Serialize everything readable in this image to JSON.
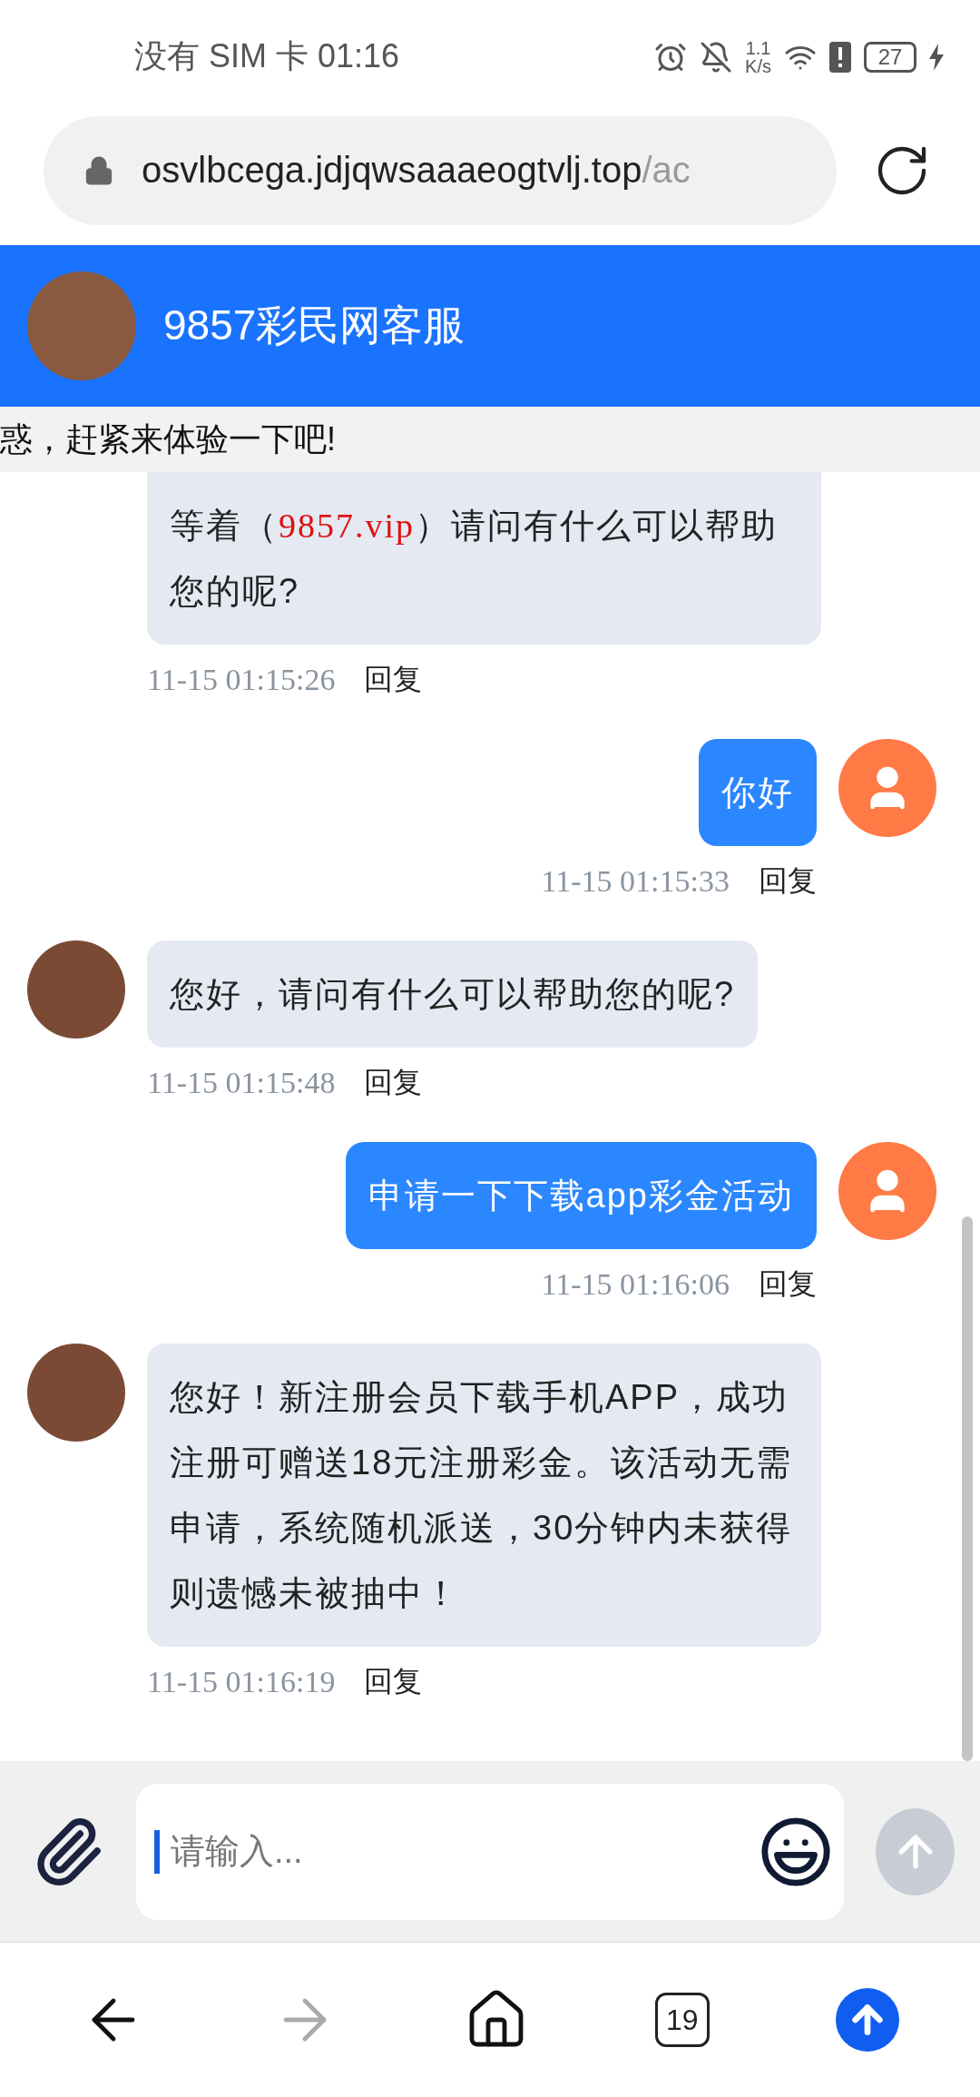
{
  "status_bar": {
    "carrier_time": "没有 SIM 卡 01:16",
    "speed_value": "1.1",
    "speed_unit": "K/s",
    "battery": "27"
  },
  "address_bar": {
    "host": "osvlbcega.jdjqwsaaaeogtvlj.top",
    "path": "/ac"
  },
  "chat_header": {
    "title": "9857彩民网客服"
  },
  "notice": "惑，赶紧来体验一下吧!",
  "messages": [
    {
      "kind": "agent_cut",
      "parts": [
        {
          "text": "等着（"
        },
        {
          "text": "9857.vip",
          "color": "#e01010"
        },
        {
          "text": "）请问有什么可以帮助您的呢?"
        }
      ],
      "time": "11-15 01:15:26",
      "reply": "回复"
    },
    {
      "kind": "user",
      "parts": [
        {
          "text": "你好"
        }
      ],
      "time": "11-15 01:15:33",
      "reply": "回复"
    },
    {
      "kind": "agent",
      "parts": [
        {
          "text": "您好，请问有什么可以帮助您的呢?"
        }
      ],
      "time": "11-15 01:15:48",
      "reply": "回复"
    },
    {
      "kind": "user",
      "parts": [
        {
          "text": "申请一下下载app彩金活动"
        }
      ],
      "time": "11-15 01:16:06",
      "reply": "回复"
    },
    {
      "kind": "agent",
      "parts": [
        {
          "text": "您好！新注册会员下载手机APP，成功注册可赠送18元注册彩金。该活动无需申请，系统随机派送，30分钟内未获得则遗憾未被抽中！"
        }
      ],
      "time": "11-15 01:16:19",
      "reply": "回复"
    }
  ],
  "composer": {
    "placeholder": "请输入..."
  },
  "nav": {
    "tab_count": "19",
    "forward": {
      "disabled": true
    }
  }
}
